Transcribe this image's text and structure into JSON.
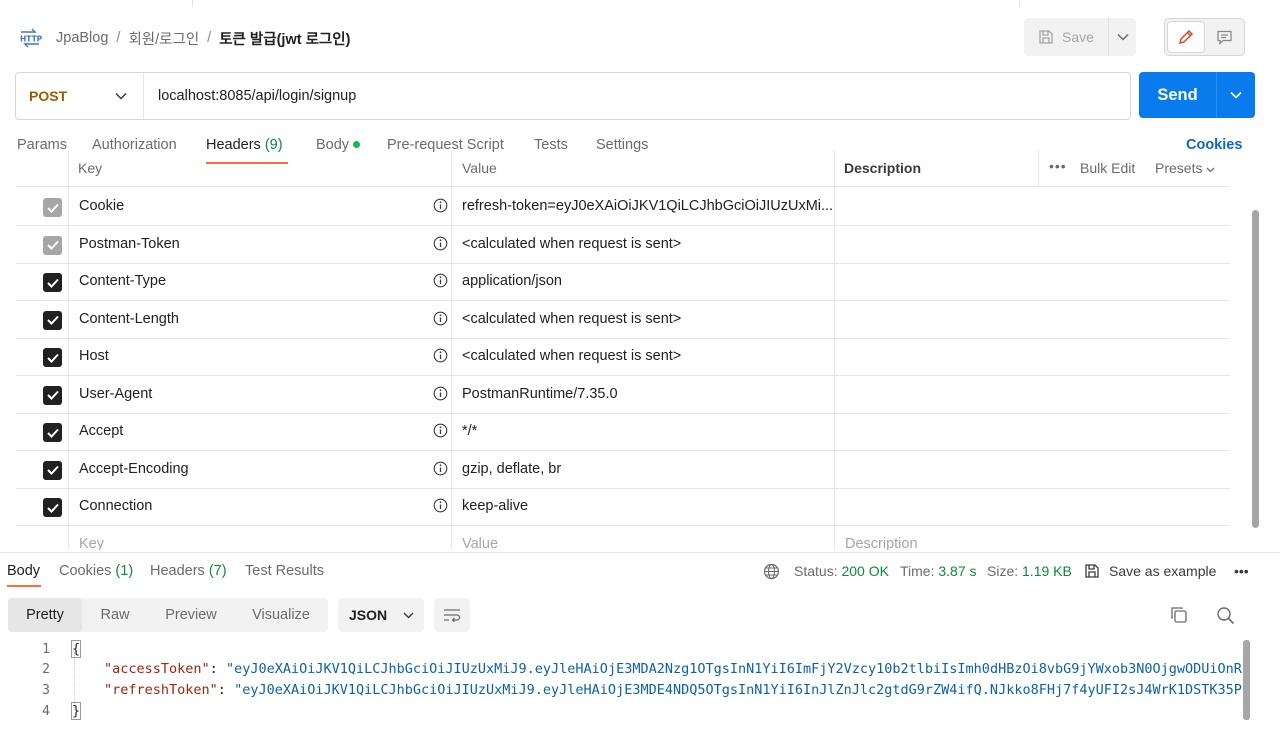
{
  "header": {
    "http_icon_label": "HTTP",
    "breadcrumb": [
      "JpaBlog",
      "회원/로그인"
    ],
    "title": "토큰 발급(jwt 로그인)",
    "save_label": "Save"
  },
  "request": {
    "method": "POST",
    "url": "localhost:8085/api/login/signup",
    "send_label": "Send"
  },
  "request_tabs": {
    "params": "Params",
    "authorization": "Authorization",
    "headers": "Headers",
    "headers_count": "(9)",
    "body": "Body",
    "prerequest": "Pre-request Script",
    "tests": "Tests",
    "settings": "Settings",
    "cookies": "Cookies"
  },
  "headers_table": {
    "col_key": "Key",
    "col_value": "Value",
    "col_description": "Description",
    "more": "•••",
    "bulk_edit": "Bulk Edit",
    "presets": "Presets",
    "rows": [
      {
        "key": "Cookie",
        "value": "refresh-token=eyJ0eXAiOiJKV1QiLCJhbGciOiJIUzUxMi...",
        "checked": true,
        "disabled": true
      },
      {
        "key": "Postman-Token",
        "value": "<calculated when request is sent>",
        "checked": true,
        "disabled": true
      },
      {
        "key": "Content-Type",
        "value": "application/json",
        "checked": true,
        "disabled": false
      },
      {
        "key": "Content-Length",
        "value": "<calculated when request is sent>",
        "checked": true,
        "disabled": false
      },
      {
        "key": "Host",
        "value": "<calculated when request is sent>",
        "checked": true,
        "disabled": false
      },
      {
        "key": "User-Agent",
        "value": "PostmanRuntime/7.35.0",
        "checked": true,
        "disabled": false
      },
      {
        "key": "Accept",
        "value": "*/*",
        "checked": true,
        "disabled": false
      },
      {
        "key": "Accept-Encoding",
        "value": "gzip, deflate, br",
        "checked": true,
        "disabled": false
      },
      {
        "key": "Connection",
        "value": "keep-alive",
        "checked": true,
        "disabled": false
      }
    ],
    "placeholder_key": "Key",
    "placeholder_value": "Value",
    "placeholder_description": "Description"
  },
  "response": {
    "tabs": {
      "body": "Body",
      "cookies": "Cookies",
      "cookies_count": "(1)",
      "headers": "Headers",
      "headers_count": "(7)",
      "test_results": "Test Results"
    },
    "status_label": "Status:",
    "status_value": "200 OK",
    "time_label": "Time:",
    "time_value": "3.87 s",
    "size_label": "Size:",
    "size_value": "1.19 KB",
    "save_example": "Save as example",
    "more": "•••",
    "formats": [
      "Pretty",
      "Raw",
      "Preview",
      "Visualize"
    ],
    "active_format": "Pretty",
    "language": "JSON",
    "code": {
      "line_numbers": [
        "1",
        "2",
        "3",
        "4"
      ],
      "open_brace": "{",
      "close_brace": "}",
      "access_key": "\"accessToken\"",
      "access_value": "\"eyJ0eXAiOiJKV1QiLCJhbGciOiJIUzUxMiJ9.eyJleHAiOjE3MDA2Nzg1OTgsInN1YiI6ImFjY2Vzcy10b2tlbiIsImh0dHBzOi8vbG9jYWxob3N0OjgwODUiOnR",
      "refresh_key": "\"refreshToken\"",
      "refresh_value": "\"eyJ0eXAiOiJKV1QiLCJhbGciOiJIUzUxMiJ9.eyJleHAiOjE3MDE4NDQ5OTgsInN1YiI6InJlZnJlc2gtdG9rZW4ifQ.NJkko8FHj7f4yUFI2sJ4WrK1DSTK35P"
    }
  },
  "colors": {
    "accent_orange": "#ff6c37",
    "send_blue": "#097bed",
    "method_post": "#a25a00",
    "status_green": "#0c8a3e"
  }
}
